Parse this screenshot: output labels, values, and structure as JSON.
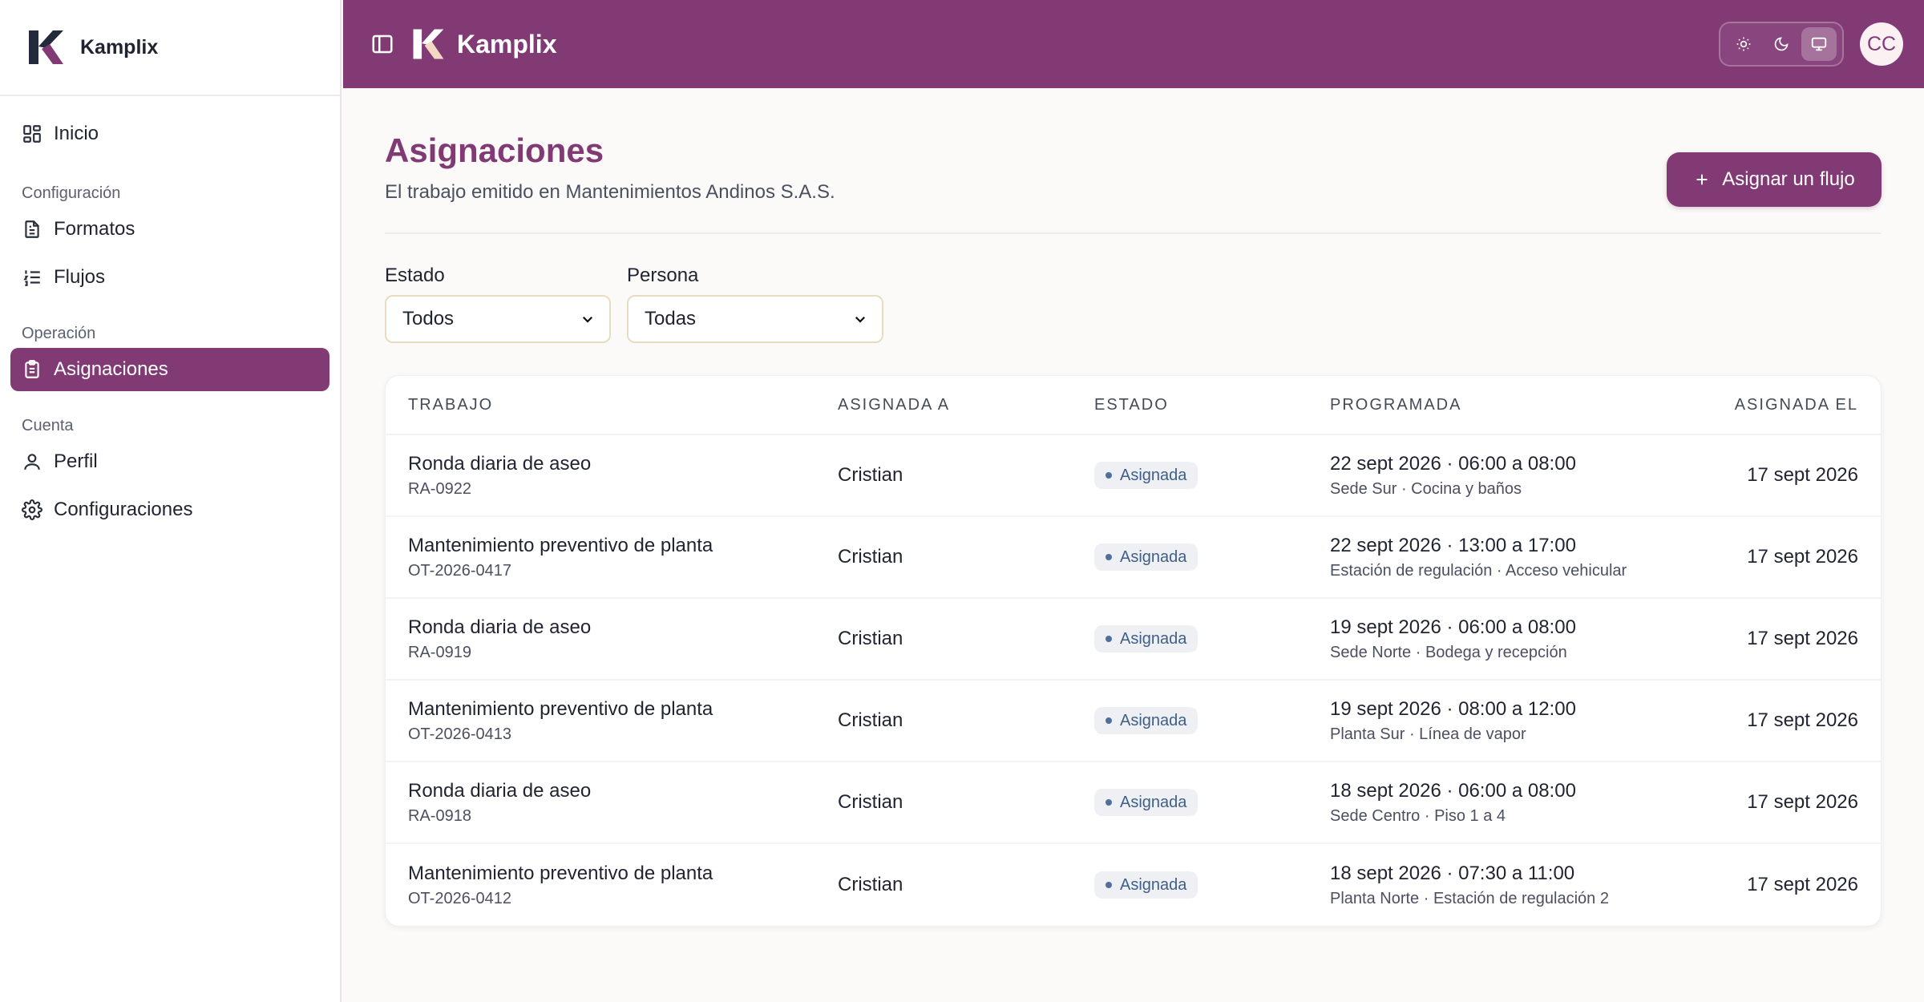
{
  "app": {
    "name": "Kamplix"
  },
  "sidebar": {
    "home": "Inicio",
    "sections": {
      "config": {
        "label": "Configuración",
        "items": [
          "Formatos",
          "Flujos"
        ]
      },
      "operation": {
        "label": "Operación",
        "items": [
          "Asignaciones"
        ]
      },
      "account": {
        "label": "Cuenta",
        "items": [
          "Perfil",
          "Configuraciones"
        ]
      }
    },
    "active_item": "Asignaciones"
  },
  "topbar": {
    "title": "Kamplix",
    "theme_options": [
      "light",
      "dark",
      "system"
    ],
    "theme_selected": "system",
    "avatar_initials": "CC"
  },
  "page": {
    "title": "Asignaciones",
    "subtitle": "El trabajo emitido en Mantenimientos Andinos S.A.S.",
    "primary_action": "Asignar un flujo"
  },
  "filters": {
    "estado": {
      "label": "Estado",
      "value": "Todos"
    },
    "persona": {
      "label": "Persona",
      "value": "Todas"
    }
  },
  "table": {
    "headers": [
      "TRABAJO",
      "ASIGNADA A",
      "ESTADO",
      "PROGRAMADA",
      "ASIGNADA EL"
    ],
    "rows": [
      {
        "title": "Ronda diaria de aseo",
        "code": "RA-0922",
        "assignee": "Cristian",
        "status": "Asignada",
        "schedule": "22 sept 2026 · 06:00 a 08:00",
        "location": "Sede Sur · Cocina y baños",
        "assigned_on": "17 sept 2026"
      },
      {
        "title": "Mantenimiento preventivo de planta",
        "code": "OT-2026-0417",
        "assignee": "Cristian",
        "status": "Asignada",
        "schedule": "22 sept 2026 · 13:00 a 17:00",
        "location": "Estación de regulación · Acceso vehicular",
        "assigned_on": "17 sept 2026"
      },
      {
        "title": "Ronda diaria de aseo",
        "code": "RA-0919",
        "assignee": "Cristian",
        "status": "Asignada",
        "schedule": "19 sept 2026 · 06:00 a 08:00",
        "location": "Sede Norte · Bodega y recepción",
        "assigned_on": "17 sept 2026"
      },
      {
        "title": "Mantenimiento preventivo de planta",
        "code": "OT-2026-0413",
        "assignee": "Cristian",
        "status": "Asignada",
        "schedule": "19 sept 2026 · 08:00 a 12:00",
        "location": "Planta Sur · Línea de vapor",
        "assigned_on": "17 sept 2026"
      },
      {
        "title": "Ronda diaria de aseo",
        "code": "RA-0918",
        "assignee": "Cristian",
        "status": "Asignada",
        "schedule": "18 sept 2026 · 06:00 a 08:00",
        "location": "Sede Centro · Piso 1 a 4",
        "assigned_on": "17 sept 2026"
      },
      {
        "title": "Mantenimiento preventivo de planta",
        "code": "OT-2026-0412",
        "assignee": "Cristian",
        "status": "Asignada",
        "schedule": "18 sept 2026 · 07:30 a 11:00",
        "location": "Planta Norte · Estación de regulación 2",
        "assigned_on": "17 sept 2026"
      }
    ]
  },
  "colors": {
    "brand": "#823a75",
    "badge_text": "#3f5f86",
    "badge_bg": "#eef0f4"
  }
}
